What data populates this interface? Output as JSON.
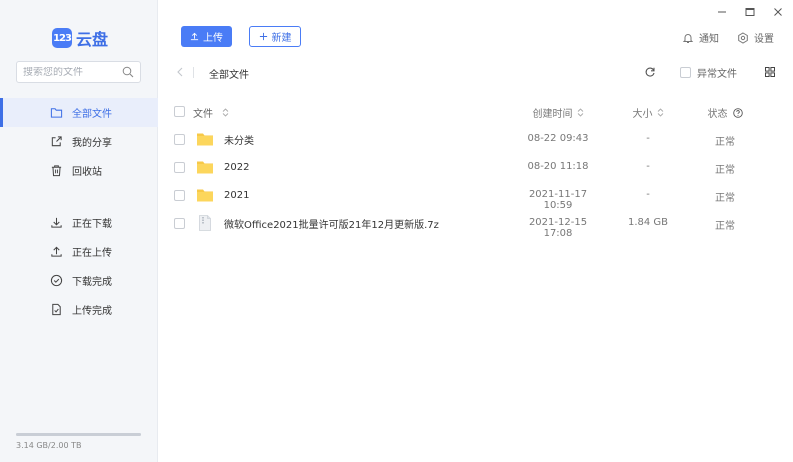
{
  "window": {
    "controls": [
      "minimize",
      "maximize",
      "close"
    ]
  },
  "brand": {
    "logo_mark": "123",
    "logo_text": "云盘",
    "color": "#3e6fe6"
  },
  "search": {
    "placeholder": "搜索您的文件"
  },
  "sidebar": {
    "items": [
      {
        "label": "全部文件",
        "icon": "folder-icon",
        "active": true
      },
      {
        "label": "我的分享",
        "icon": "share-icon"
      },
      {
        "label": "回收站",
        "icon": "trash-icon"
      },
      {
        "label": "正在下载",
        "icon": "download-icon"
      },
      {
        "label": "正在上传",
        "icon": "upload-icon"
      },
      {
        "label": "下载完成",
        "icon": "check-circle-icon"
      },
      {
        "label": "上传完成",
        "icon": "file-check-icon"
      }
    ],
    "storage": "3.14 GB/2.00 TB"
  },
  "toolbar": {
    "upload_label": "上传",
    "new_label": "新建",
    "notify_label": "通知",
    "settings_label": "设置",
    "breadcrumb": "全部文件",
    "abnormal_label": "异常文件"
  },
  "table": {
    "headers": {
      "name": "文件",
      "created": "创建时间",
      "size": "大小",
      "status": "状态"
    },
    "rows": [
      {
        "name": "未分类",
        "type": "folder",
        "created": "08-22 09:43",
        "size": "-",
        "status": "正常"
      },
      {
        "name": "2022",
        "type": "folder",
        "created": "08-20 11:18",
        "size": "-",
        "status": "正常"
      },
      {
        "name": "2021",
        "type": "folder",
        "created": "2021-11-17 10:59",
        "size": "-",
        "status": "正常"
      },
      {
        "name": "微软Office2021批量许可版21年12月更新版.7z",
        "type": "archive",
        "created": "2021-12-15 17:08",
        "size": "1.84 GB",
        "status": "正常"
      }
    ]
  },
  "colors": {
    "accent": "#4a7cf6",
    "folder": "#f7c948",
    "sidebar_bg": "#f4f6f9"
  }
}
